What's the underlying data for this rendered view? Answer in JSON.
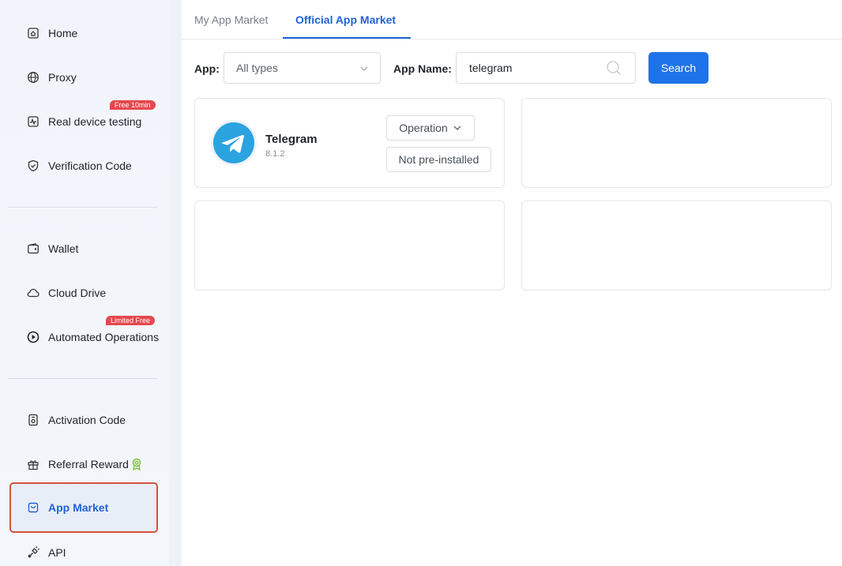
{
  "sidebar": {
    "items": [
      {
        "label": "Home",
        "icon": "home-icon"
      },
      {
        "label": "Proxy",
        "icon": "globe-icon"
      },
      {
        "label": "Real device testing",
        "icon": "pulse-icon",
        "badge": "Free 10min"
      },
      {
        "label": "Verification Code",
        "icon": "shield-check-icon"
      },
      {
        "label": "Wallet",
        "icon": "wallet-icon"
      },
      {
        "label": "Cloud Drive",
        "icon": "cloud-icon"
      },
      {
        "label": "Automated Operations",
        "icon": "play-circle-icon",
        "badge": "Limited Free"
      },
      {
        "label": "Activation Code",
        "icon": "code-card-icon"
      },
      {
        "label": "Referral Reward",
        "icon": "gift-icon"
      },
      {
        "label": "App Market",
        "icon": "shop-bag-icon",
        "active": true
      },
      {
        "label": "API",
        "icon": "plug-icon"
      }
    ]
  },
  "tabs": [
    {
      "label": "My App Market"
    },
    {
      "label": "Official App Market",
      "active": true
    }
  ],
  "filters": {
    "app_label": "App:",
    "app_select_value": "All types",
    "app_name_label": "App Name:",
    "app_name_value": "telegram",
    "search_label": "Search"
  },
  "apps": [
    {
      "name": "Telegram",
      "version": "8.1.2",
      "operation_label": "Operation",
      "status_label": "Not pre-installed"
    }
  ],
  "colors": {
    "accent": "#1f73e8",
    "active_text": "#1f63d6",
    "badge": "#e5484d",
    "highlight_border": "#d9503f",
    "telegram": "#2aa3df"
  }
}
